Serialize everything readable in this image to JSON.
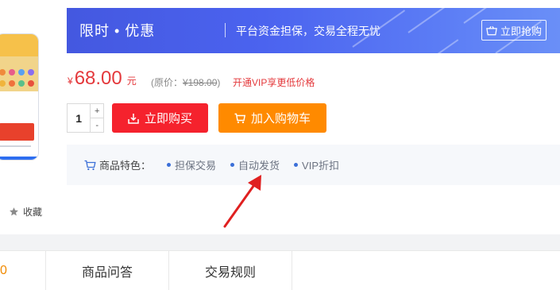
{
  "promo": {
    "title": "限时 • 优惠",
    "subtitle": "平台资金担保，交易全程无忧",
    "button_label": "立即抢购"
  },
  "price": {
    "currency": "¥",
    "amount": "68.00",
    "unit": "元",
    "original_prefix": "(原价：",
    "original_value": "¥198.00",
    "original_suffix": ")",
    "vip_link": "开通VIP享更低价格"
  },
  "purchase": {
    "quantity": "1",
    "increment_label": "+",
    "decrement_label": "-",
    "buy_now_label": "立即购买",
    "add_to_cart_label": "加入购物车"
  },
  "features": {
    "label": "商品特色：",
    "items": [
      "担保交易",
      "自动发货",
      "VIP折扣"
    ]
  },
  "gallery": {
    "collect_label": "收藏"
  },
  "tabs": {
    "items": [
      "0",
      "商品问答",
      "交易规则"
    ]
  },
  "colors": {
    "promo_gradient_start": "#4458e0",
    "promo_gradient_end": "#6a8ff7",
    "price_red": "#e4393c",
    "buy_red": "#f5222d",
    "cart_orange": "#ff8a00",
    "feature_dot_blue": "#3b6fd8",
    "arrow_red": "#e02020"
  },
  "icons": {
    "promo_button": "basket-icon",
    "buy_button": "download-box-icon",
    "cart_button": "cart-icon",
    "features": "cart-icon",
    "collect": "star-icon"
  }
}
